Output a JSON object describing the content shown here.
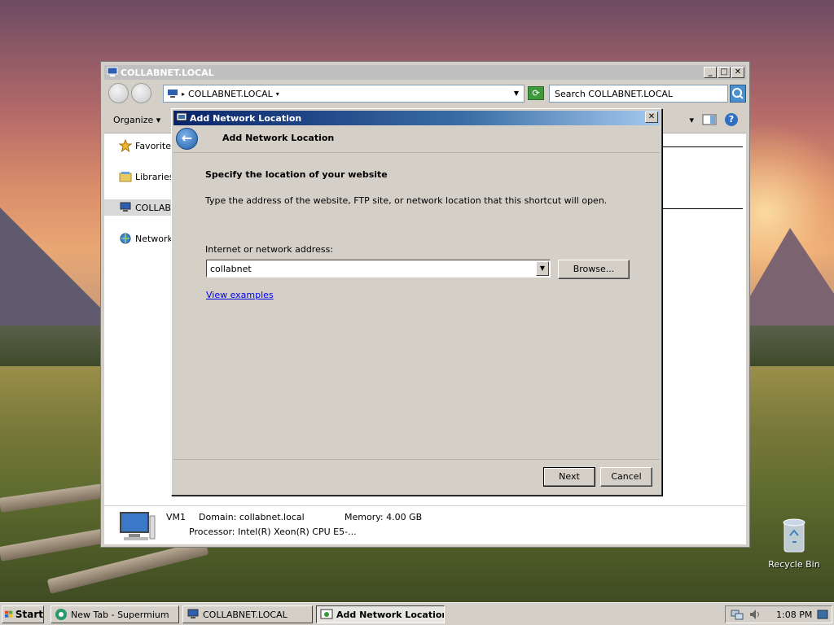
{
  "explorer": {
    "title": "COLLABNET.LOCAL",
    "address": "COLLABNET.LOCAL",
    "search_placeholder": "Search COLLABNET.LOCAL",
    "toolbar": {
      "organize": "Organize"
    },
    "nav": [
      "Favorites",
      "Libraries",
      "COLLABNET.LOCAL",
      "Network"
    ],
    "details": {
      "name": "VM1",
      "domain": "Domain: collabnet.local",
      "memory": "Memory: 4.00 GB",
      "processor": "Processor: Intel(R) Xeon(R) CPU E5-..."
    }
  },
  "dialog": {
    "title": "Add Network Location",
    "header": "Add Network Location",
    "heading": "Specify the location of your website",
    "description": "Type the address of the website, FTP site, or network location that this shortcut will open.",
    "address_label": "Internet or network address:",
    "address_value": "collabnet",
    "browse": "Browse...",
    "view_examples": "View examples",
    "next": "Next",
    "cancel": "Cancel"
  },
  "desktop": {
    "recycle_bin": "Recycle Bin"
  },
  "taskbar": {
    "start": "Start",
    "tasks": [
      "New Tab - Supermium",
      "COLLABNET.LOCAL",
      "Add Network Location"
    ],
    "clock": "1:08 PM"
  },
  "colors": {
    "dialog_title_start": "#0a246a",
    "dialog_title_end": "#a6caf0",
    "window_face": "#d4d0c8",
    "link": "#0000ee"
  },
  "icons": {
    "window_icon": "computer-icon",
    "back": "back-arrow-icon",
    "search": "search-icon",
    "refresh": "refresh-icon",
    "help": "help-icon",
    "recycle_bin": "recycle-bin-icon"
  }
}
